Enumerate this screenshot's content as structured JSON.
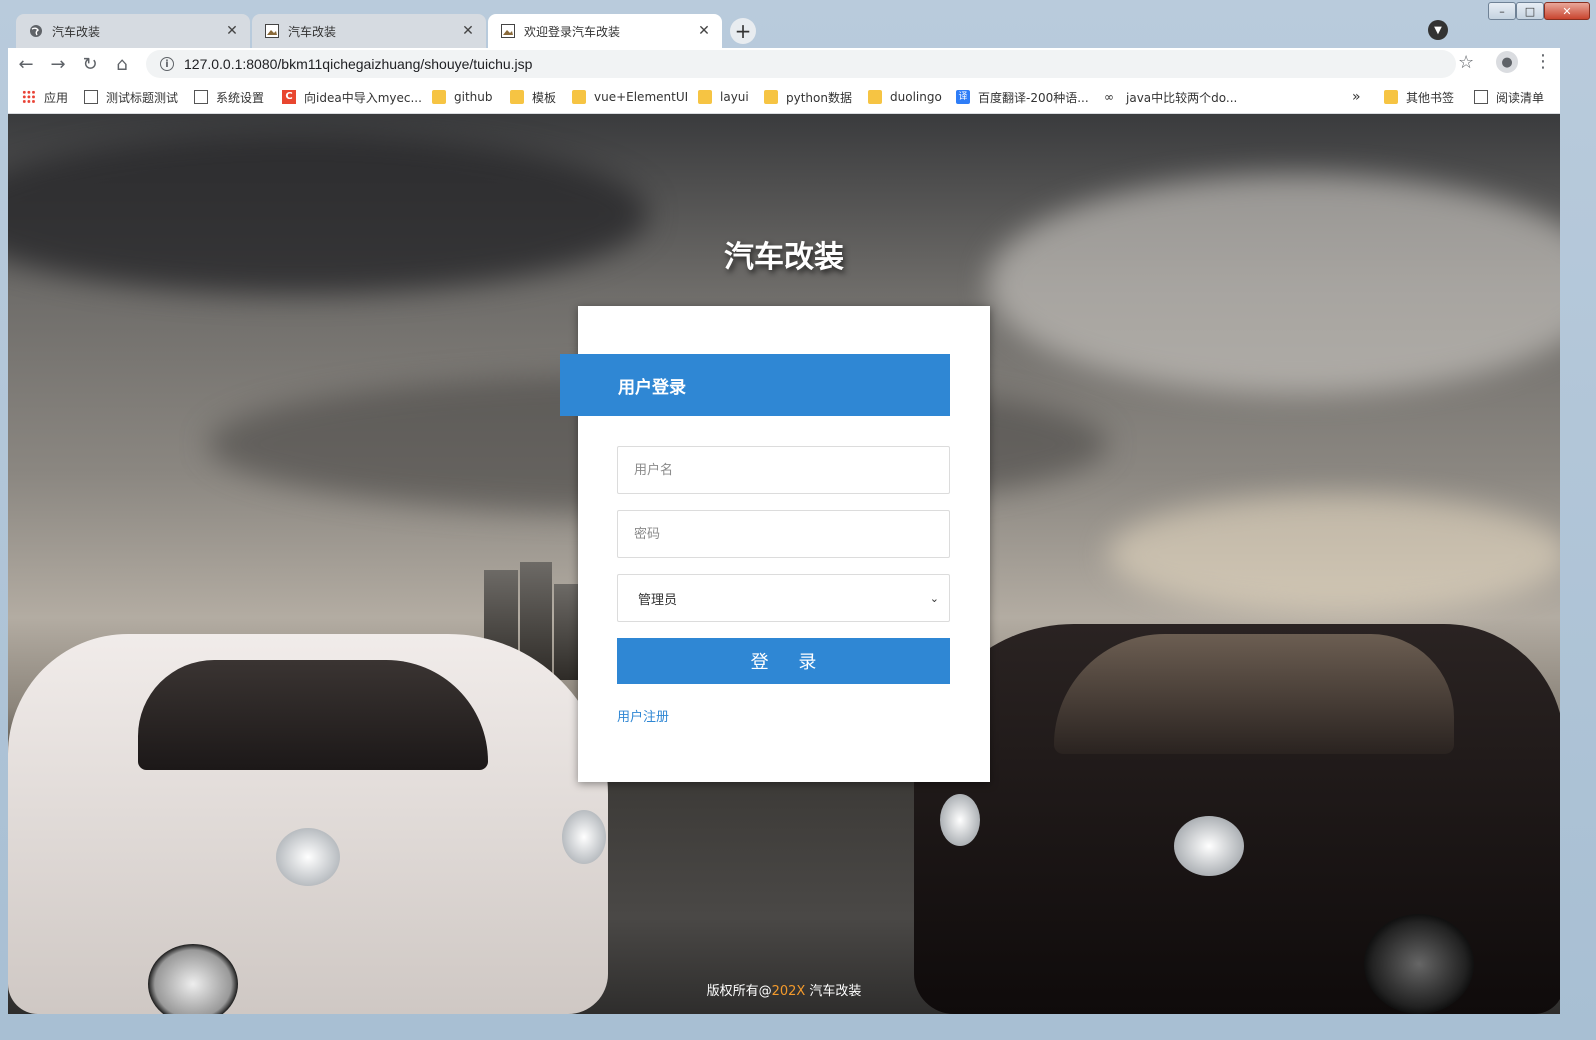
{
  "browser": {
    "tabs": [
      {
        "title": "汽车改装",
        "icon": "globe-icon"
      },
      {
        "title": "汽车改装",
        "icon": "image-icon"
      },
      {
        "title": "欢迎登录汽车改装",
        "icon": "image-icon",
        "active": true
      }
    ],
    "new_tab_label": "+",
    "url": "127.0.0.1:8080/bkm11qichegaizhuang/shouye/tuichu.jsp",
    "bookmarks": [
      {
        "label": "应用",
        "icon": "apps-grid-icon"
      },
      {
        "label": "测试标题测试",
        "icon": "image-icon"
      },
      {
        "label": "系统设置",
        "icon": "image-icon"
      },
      {
        "label": "向idea中导入myec...",
        "icon": "c-icon"
      },
      {
        "label": "github",
        "icon": "folder-icon"
      },
      {
        "label": "模板",
        "icon": "folder-icon"
      },
      {
        "label": "vue+ElementUI",
        "icon": "folder-icon"
      },
      {
        "label": "layui",
        "icon": "folder-icon"
      },
      {
        "label": "python数据",
        "icon": "folder-icon"
      },
      {
        "label": "duolingo",
        "icon": "folder-icon"
      },
      {
        "label": "百度翻译-200种语...",
        "icon": "translate-icon"
      },
      {
        "label": "java中比较两个do...",
        "icon": "link-icon"
      }
    ],
    "bookmarks_overflow": "»",
    "other_bookmarks": "其他书签",
    "reading_list": "阅读清单"
  },
  "page": {
    "site_title": "汽车改装",
    "login": {
      "header": "用户登录",
      "username_placeholder": "用户名",
      "password_placeholder": "密码",
      "role_selected": "管理员",
      "submit_label": "登 录",
      "register_link": "用户注册"
    },
    "footer": {
      "prefix": "版权所有@",
      "year": "202X",
      "suffix": " 汽车改装"
    }
  },
  "colors": {
    "accent": "#2f87d4",
    "footer_year": "#f39a2c"
  }
}
